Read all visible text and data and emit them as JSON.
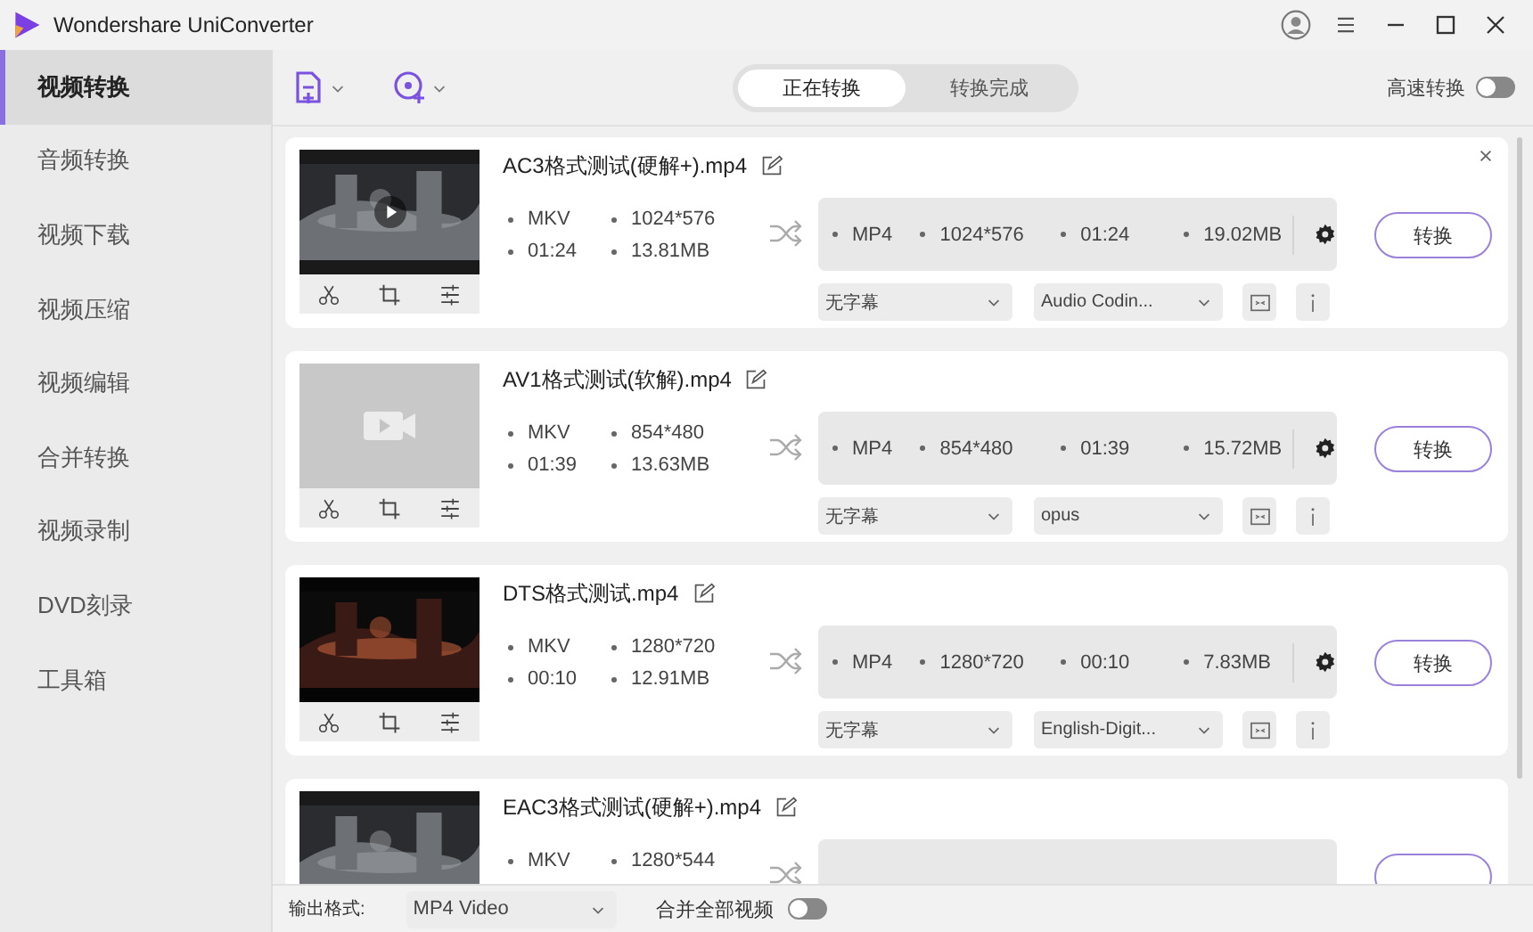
{
  "window": {
    "title": "Wondershare UniConverter"
  },
  "sidebar": {
    "items": [
      {
        "label": "视频转换",
        "selected": true
      },
      {
        "label": "音频转换",
        "selected": false
      },
      {
        "label": "视频下载",
        "selected": false
      },
      {
        "label": "视频压缩",
        "selected": false
      },
      {
        "label": "视频编辑",
        "selected": false
      },
      {
        "label": "合并转换",
        "selected": false
      },
      {
        "label": "视频录制",
        "selected": false
      },
      {
        "label": "DVD刻录",
        "selected": false
      },
      {
        "label": "工具箱",
        "selected": false
      }
    ]
  },
  "toolbar": {
    "segments": [
      {
        "label": "正在转换",
        "selected": true
      },
      {
        "label": "转换完成",
        "selected": false
      }
    ],
    "high_speed": {
      "label": "高速转换",
      "on": false
    }
  },
  "files": [
    {
      "name": "AC3格式测试(硬解+).mp4",
      "thumbnail": {
        "kind": "picture",
        "play": true
      },
      "closable": true,
      "source": [
        "MKV",
        "1024*576",
        "01:24",
        "13.81MB"
      ],
      "output": [
        "MP4",
        "1024*576",
        "01:24",
        "19.02MB"
      ],
      "subtitle": "无字幕",
      "audio": "Audio Codin...",
      "convert": "转换"
    },
    {
      "name": "AV1格式测试(软解).mp4",
      "thumbnail": {
        "kind": "placeholder",
        "play": false
      },
      "closable": false,
      "source": [
        "MKV",
        "854*480",
        "01:39",
        "13.63MB"
      ],
      "output": [
        "MP4",
        "854*480",
        "01:39",
        "15.72MB"
      ],
      "subtitle": "无字幕",
      "audio": "opus",
      "convert": "转换"
    },
    {
      "name": "DTS格式测试.mp4",
      "thumbnail": {
        "kind": "picture",
        "play": false
      },
      "closable": false,
      "source": [
        "MKV",
        "1280*720",
        "00:10",
        "12.91MB"
      ],
      "output": [
        "MP4",
        "1280*720",
        "00:10",
        "7.83MB"
      ],
      "subtitle": "无字幕",
      "audio": "English-Digit...",
      "convert": "转换"
    },
    {
      "name": "EAC3格式测试(硬解+).mp4",
      "thumbnail": {
        "kind": "picture",
        "play": false
      },
      "closable": false,
      "source": [
        "MKV",
        "1280*544"
      ]
    }
  ],
  "bottom_bar": {
    "format_label": "输出格式:",
    "format_value": "MP4 Video",
    "merge": {
      "label": "合并全部视频",
      "on": false
    }
  }
}
